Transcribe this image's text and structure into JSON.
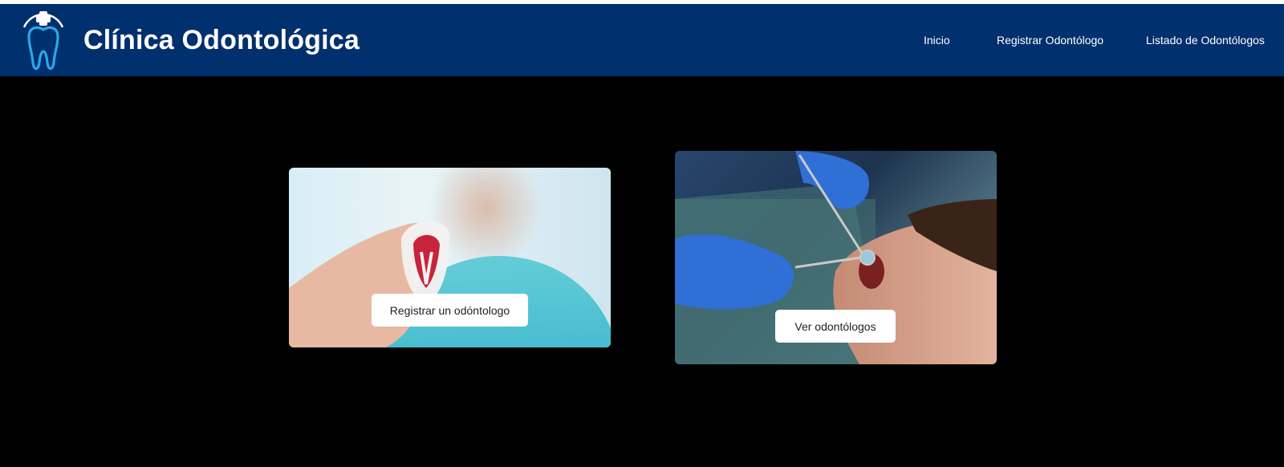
{
  "header": {
    "brand_title": "Clínica Odontológica",
    "logo_icon": "tooth-with-cross-icon",
    "background_color": "#01306e",
    "nav": [
      {
        "label": "Inicio"
      },
      {
        "label": "Registrar Odontólogo"
      },
      {
        "label": "Listado de Odontólogos"
      }
    ]
  },
  "cards": [
    {
      "image": "dentist-holding-tooth-model-photo",
      "button_label": "Registrar un odóntologo"
    },
    {
      "image": "patient-dental-exam-photo",
      "button_label": "Ver odontólogos"
    }
  ],
  "colors": {
    "page_background": "#000000",
    "button_background": "#ffffff"
  }
}
